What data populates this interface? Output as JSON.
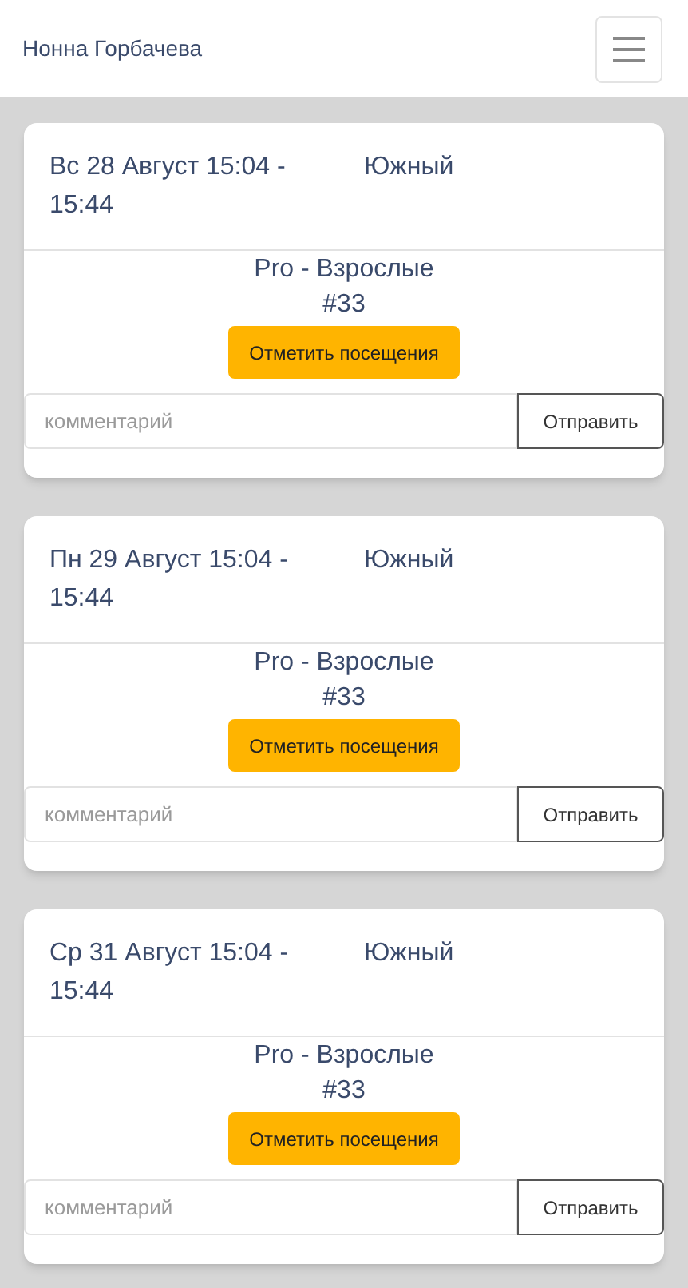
{
  "navbar": {
    "title": "Нонна Горбачева"
  },
  "cards": [
    {
      "date": "Вс 28 Август 15:04 - 15:44",
      "location": "Южный",
      "group": "Pro - Взрослые",
      "number": "#33",
      "mark_button": "Отметить посещения",
      "comment_placeholder": "комментарий",
      "send_button": "Отправить"
    },
    {
      "date": "Пн 29 Август 15:04 - 15:44",
      "location": "Южный",
      "group": "Pro - Взрослые",
      "number": "#33",
      "mark_button": "Отметить посещения",
      "comment_placeholder": "комментарий",
      "send_button": "Отправить"
    },
    {
      "date": "Ср 31 Август 15:04 - 15:44",
      "location": "Южный",
      "group": "Pro - Взрослые",
      "number": "#33",
      "mark_button": "Отметить посещения",
      "comment_placeholder": "комментарий",
      "send_button": "Отправить"
    }
  ]
}
